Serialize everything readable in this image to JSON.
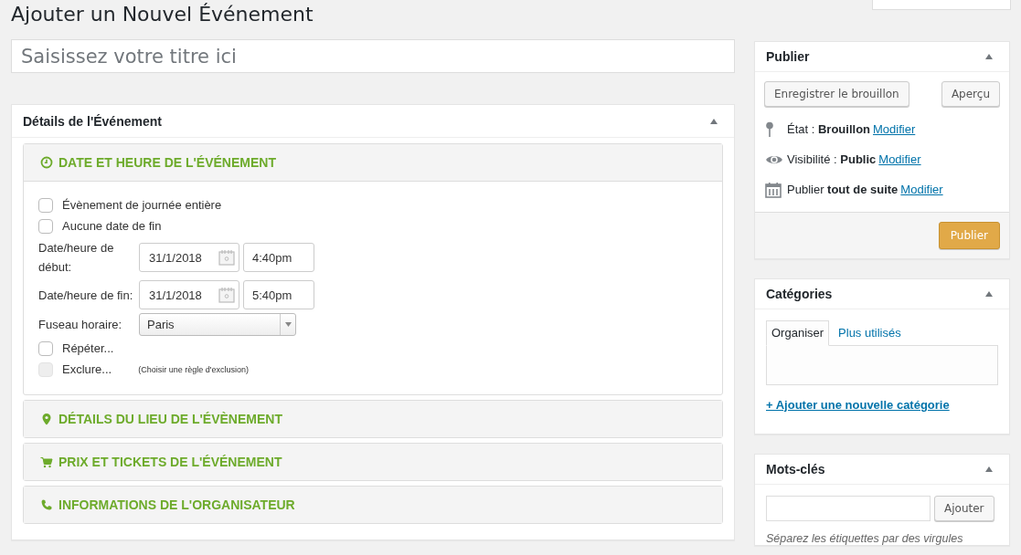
{
  "page_title": "Ajouter un Nouvel Événement",
  "title_field": {
    "placeholder": "Saisissez votre titre ici"
  },
  "details_box": {
    "title": "Détails de l'Événement",
    "expanded": true,
    "sections": [
      {
        "kind": "clock",
        "title": "DATE ET HEURE DE L'ÉVÉNEMENT",
        "expanded": true,
        "fields": [
          {
            "kind": "checkbox",
            "label": "Évènement de journée entière",
            "checked": false,
            "disabled": false
          },
          {
            "kind": "checkbox",
            "label": "Aucune date de fin",
            "checked": false,
            "disabled": false
          },
          {
            "kind": "datetime",
            "label": "Date/heure de début:",
            "date": "31/1/2018",
            "time": "4:40pm"
          },
          {
            "kind": "datetime",
            "label": "Date/heure de fin:",
            "date": "31/1/2018",
            "time": "5:40pm"
          },
          {
            "kind": "select",
            "label": "Fuseau horaire:",
            "value": "Paris"
          },
          {
            "kind": "checkbox",
            "label": "Répéter...",
            "checked": false,
            "disabled": false
          },
          {
            "kind": "checkbox",
            "label": "Exclure...",
            "checked": false,
            "disabled": true,
            "note": "(Choisir une règle d'exclusion)"
          }
        ]
      },
      {
        "kind": "pin",
        "title": "DÉTAILS DU LIEU DE L'ÉVÈNEMENT",
        "expanded": false
      },
      {
        "kind": "cart",
        "title": "PRIX ET TICKETS DE L'ÉVÉNEMENT",
        "expanded": false
      },
      {
        "kind": "phone",
        "title": "INFORMATIONS DE L'ORGANISATEUR",
        "expanded": false
      }
    ]
  },
  "publish_box": {
    "title": "Publier",
    "expanded": true,
    "save_button": "Enregistrer le brouillon",
    "preview_button": "Aperçu",
    "rows": [
      {
        "kind": "pin",
        "label": "État : ",
        "value": "Brouillon",
        "link": "Modifier"
      },
      {
        "kind": "eye",
        "label": "Visibilité : ",
        "value": "Public",
        "link": "Modifier"
      },
      {
        "kind": "calendar",
        "label": "Publier ",
        "value": "tout de suite",
        "link": "Modifier"
      }
    ],
    "publish_button": "Publier"
  },
  "categories_box": {
    "title": "Catégories",
    "expanded": true,
    "tabs": [
      {
        "label": "Organiser",
        "selected": true
      },
      {
        "label": "Plus utilisés",
        "selected": false
      }
    ],
    "add_link": "+ Ajouter une nouvelle catégorie"
  },
  "tags_box": {
    "title": "Mots-clés",
    "expanded": true,
    "add_button": "Ajouter",
    "hint": "Séparez les étiquettes par des virgules"
  }
}
